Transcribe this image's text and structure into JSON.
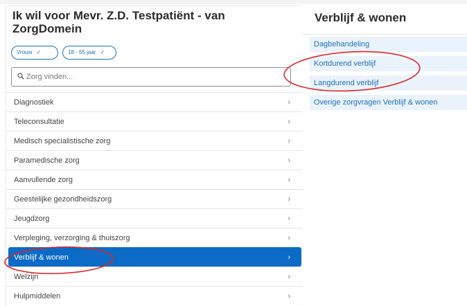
{
  "left_panel": {
    "title": "Ik wil voor Mevr. Z.D. Testpatiënt - van ZorgDomein",
    "filters": [
      {
        "label": "Vrouw",
        "check": "✓"
      },
      {
        "label": "18 - 65 jaar",
        "check": "✓"
      }
    ],
    "search": {
      "placeholder": "Zorg vinden..."
    },
    "menu": [
      {
        "label": "Diagnostiek"
      },
      {
        "label": "Teleconsultatie"
      },
      {
        "label": "Medisch specialistische zorg"
      },
      {
        "label": "Paramedische zorg"
      },
      {
        "label": "Aanvullende zorg"
      },
      {
        "label": "Geestelijke gezondheidszorg"
      },
      {
        "label": "Jeugdzorg"
      },
      {
        "label": "Verpleging, verzorging & thuiszorg"
      },
      {
        "label": "Verblijf & wonen",
        "active": true
      },
      {
        "label": "Welzijn"
      },
      {
        "label": "Hulpmiddelen"
      }
    ],
    "chevron": "›"
  },
  "right_panel": {
    "title": "Verblijf & wonen",
    "items": [
      {
        "label": "Dagbehandeling"
      },
      {
        "label": "Kortdurend verblijf"
      },
      {
        "label": "Langdurend verblijf"
      },
      {
        "label": "Overige zorgvragen Verblijf & wonen"
      }
    ]
  },
  "colors": {
    "accent": "#0b6bc6",
    "link": "#1f6fb5",
    "item_bg": "#eaf3fb",
    "annotation": "#d9262b"
  },
  "icons": {
    "search": "search-icon",
    "chevron": "chevron-right-icon",
    "check": "check-icon"
  }
}
